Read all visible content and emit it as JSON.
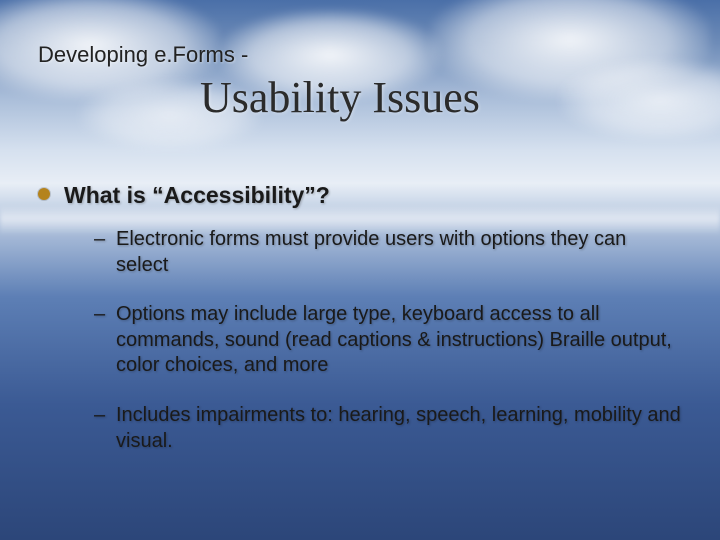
{
  "supertitle": "Developing e.Forms -",
  "title": "Usability Issues",
  "bullet": {
    "heading": "What is “Accessibility”?",
    "items": [
      "Electronic forms must provide users with options they can select",
      "Options may include large type, keyboard access to all commands, sound (read captions & instructions) Braille output, color choices, and more",
      "Includes impairments to: hearing, speech, learning, mobility and visual."
    ]
  },
  "dash": "–"
}
